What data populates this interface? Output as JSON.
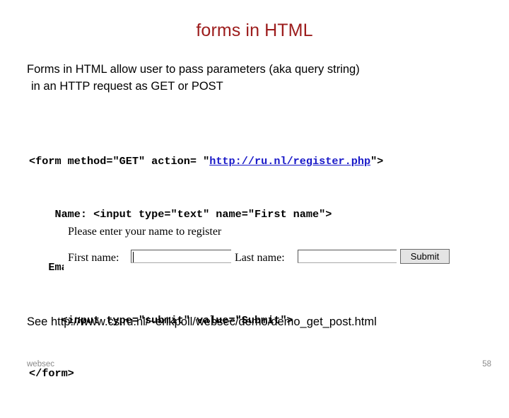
{
  "slide": {
    "title": "forms in HTML",
    "title_color": "#9c1c1c",
    "intro_line1": "Forms in HTML allow user to pass parameters (aka query string)",
    "intro_line2": "in an HTTP request as GET or POST",
    "code": {
      "line1_pre": "<form method=\"GET\" action= \"",
      "line1_url": "http://ru.nl/register.php",
      "line1_post": "\">",
      "line2": "    Name: <input type=\"text\" name=\"First name\">",
      "line3": "   Email: <input type=\"text\" name=\"Last name\">",
      "line4": "     <input type=\"submit\" value=\"Submit\">",
      "line5": "</form>",
      "url_color": "#1919c8"
    },
    "form_preview": {
      "prompt": "Please enter your name to register",
      "first_name_label": "First name:",
      "first_name_value": "",
      "last_name_label": "Last name:",
      "last_name_value": "",
      "submit_label": "Submit"
    },
    "see_line": "See http://www.cs.ru.nl/~erikpoll/websec/demo/demo_get_post.html",
    "footer_left": "websec",
    "footer_right": "58"
  }
}
